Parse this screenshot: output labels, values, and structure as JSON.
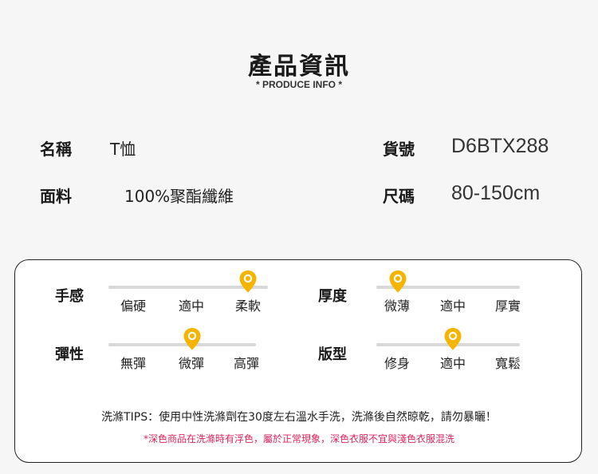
{
  "header": {
    "title": "產品資訊",
    "subtitle": "* PRODUCE INFO *"
  },
  "info": {
    "name_label": "名稱",
    "name_value": "T恤",
    "sku_label": "貨號",
    "sku_value": "D6BTX288",
    "material_label": "面料",
    "material_value": "100%聚酯纖維",
    "size_label": "尺碼",
    "size_value": "80-150cm"
  },
  "attributes": {
    "feel": {
      "label": "手感",
      "options": [
        "偏硬",
        "適中",
        "柔軟"
      ],
      "selected": 2
    },
    "thickness": {
      "label": "厚度",
      "options": [
        "微薄",
        "適中",
        "厚實"
      ],
      "selected": 0
    },
    "elasticity": {
      "label": "彈性",
      "options": [
        "無彈",
        "微彈",
        "高彈"
      ],
      "selected": 1
    },
    "fit": {
      "label": "版型",
      "options": [
        "修身",
        "適中",
        "寬鬆"
      ],
      "selected": 1
    }
  },
  "care": {
    "tips": "洗滌TIPS：使用中性洗滌劑在30度左右溫水手洗，洗滌後自然晾乾，請勿暴曬！",
    "note": "*深色商品在洗滌時有浮色，屬於正常現象，深色衣服不宜與淺色衣服混洗"
  },
  "colors": {
    "pin": "#f5b400",
    "note_text": "#e0245a"
  },
  "icons": {
    "selector": "map-pin-icon"
  }
}
